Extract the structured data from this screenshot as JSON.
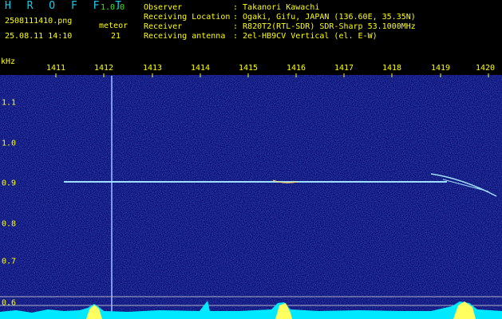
{
  "app": {
    "name": "H R O F F T",
    "version": "1.0.0"
  },
  "file_name": "2508111410.png",
  "datetime": "25.08.11 14:10",
  "meteor_label": "meteor",
  "meteor_count": "21",
  "info": [
    {
      "key": "Observer",
      "value": ": Takanori Kawachi"
    },
    {
      "key": "Receiving Location",
      "value": ": Ogaki, Gifu, JAPAN (136.60E, 35.35N)"
    },
    {
      "key": "Receiver",
      "value": ": R820T2(RTL-SDR) SDR-Sharp 53.1000MHz"
    },
    {
      "key": "Receiving antenna",
      "value": ": 2el-HB9CV Vertical (el. E-W)"
    }
  ],
  "axis_unit": "kHz",
  "x_ticks": [
    "1411",
    "1412",
    "1413",
    "1414",
    "1415",
    "1416",
    "1417",
    "1418",
    "1419",
    "1420"
  ],
  "y_ticks": [
    "1.1",
    "1.0",
    "0.9",
    "0.8",
    "0.7",
    "0.6"
  ],
  "colors": {
    "background": "#000000",
    "spectrogram_base": "#06086e",
    "trace": "#9fdfff",
    "text": "#ffff00",
    "cyan": "#10d0f0",
    "spectrum_fill": "#00e8ff"
  }
}
